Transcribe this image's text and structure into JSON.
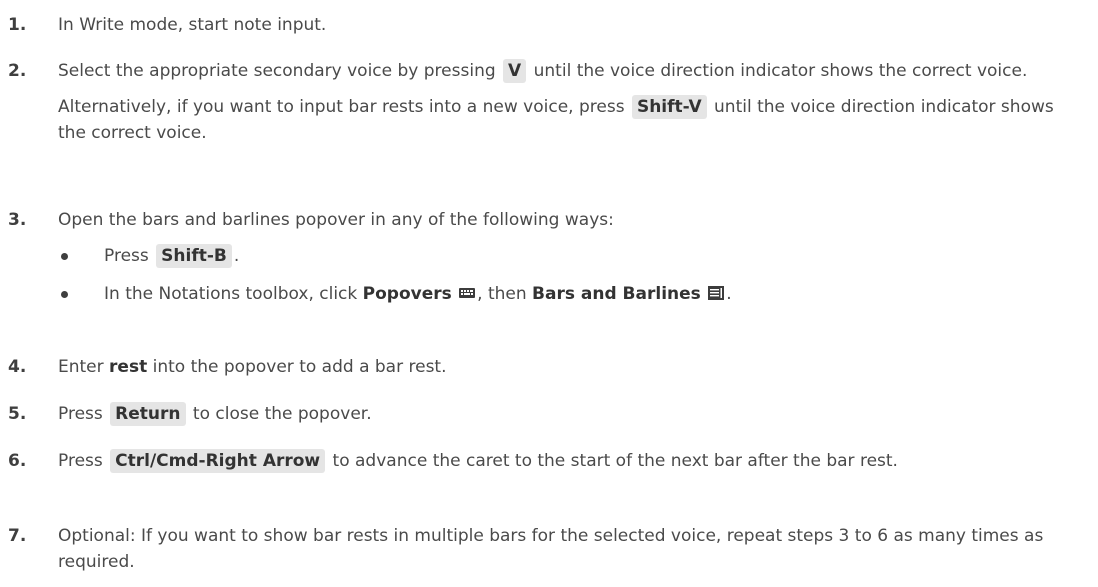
{
  "steps": [
    {
      "num": "1.",
      "text": "In Write mode, start note input."
    },
    {
      "num": "2.",
      "p1_a": "Select the appropriate secondary voice by pressing",
      "p1_key": "V",
      "p1_b": "until the voice direction indicator shows the correct voice.",
      "p2_a": "Alternatively, if you want to input bar rests into a new voice, press",
      "p2_key": "Shift-V",
      "p2_b": "until the voice direction indicator shows the correct voice."
    },
    {
      "num": "3.",
      "text": "Open the bars and barlines popover in any of the following ways:",
      "bullet1_a": "Press",
      "bullet1_key": "Shift-B",
      "bullet1_b": ".",
      "bullet2_a": "In the Notations toolbox, click",
      "bullet2_popovers": "Popovers",
      "bullet2_then": ", then",
      "bullet2_bars": "Bars and Barlines",
      "bullet2_end": ".",
      "icons": [
        "keyboard-icon",
        "bars-and-barlines-icon"
      ]
    },
    {
      "num": "4.",
      "a": "Enter",
      "bold": "rest",
      "b": "into the popover to add a bar rest."
    },
    {
      "num": "5.",
      "a": "Press",
      "key": "Return",
      "b": "to close the popover."
    },
    {
      "num": "6.",
      "a": "Press",
      "key": "Ctrl/Cmd-Right Arrow",
      "b": "to advance the caret to the start of the next bar after the bar rest."
    },
    {
      "num": "7.",
      "text": "Optional: If you want to show bar rests in multiple bars for the selected voice, repeat steps 3 to 6 as many times as required."
    }
  ]
}
